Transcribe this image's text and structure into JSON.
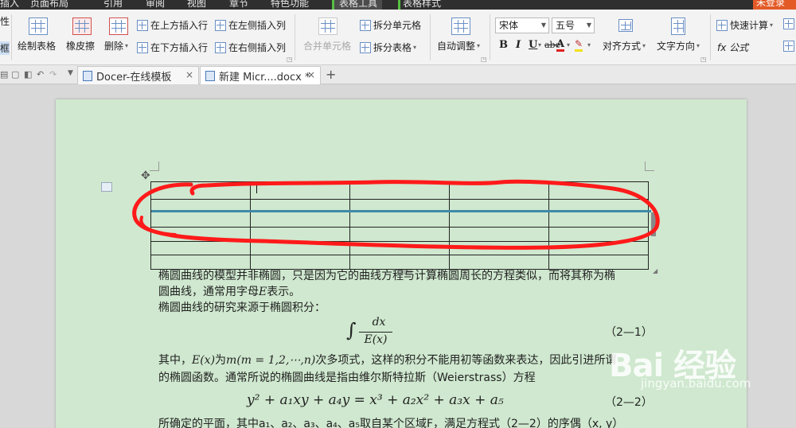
{
  "menubar": {
    "tabs": [
      "插入",
      "页面布局",
      "引用",
      "审阅",
      "视图",
      "章节",
      "特色功能",
      "表格工具",
      "表格样式"
    ],
    "login": "未登录"
  },
  "ribbon": {
    "left_partial_1": "性",
    "left_partial_2": "框",
    "draw_table": "绘制表格",
    "eraser": "橡皮擦",
    "delete": "删除",
    "insert_above": "在上方插入行",
    "insert_below": "在下方插入行",
    "insert_left": "在左侧插入列",
    "insert_right": "在右侧插入列",
    "merge_cells": "合并单元格",
    "split_cells": "拆分单元格",
    "split_table": "拆分表格",
    "auto_adjust": "自动调整",
    "font_name": "宋体",
    "font_size": "五号",
    "bold": "B",
    "italic": "I",
    "underline": "U",
    "strike": "abc",
    "font_color": "A",
    "align": "对齐方式",
    "text_dir": "文字方向",
    "quick_calc": "快速计算",
    "formula": "fx 公式"
  },
  "tabs_row": {
    "tabs": [
      {
        "label": "Docer-在线模板",
        "close": "×"
      },
      {
        "label": "新建 Micr....docx *",
        "close": "×"
      }
    ],
    "add": "+"
  },
  "document": {
    "para1_line1": "椭圆曲线的模型并非椭圆，只是因为它的曲线方程与计算椭圆周长的方程类似，而将其称为椭",
    "para1_line2_a": "圆曲线，通常用字母",
    "para1_line2_var": "E",
    "para1_line2_b": "表示。",
    "para2": "椭圆曲线的研究来源于椭圆积分：",
    "eq1_int": "∫",
    "eq1_num": "dx",
    "eq1_den": "E(x)",
    "eq1_label": "（2—1）",
    "para3_a": "其中，",
    "para3_ex": "E(x)",
    "para3_b": "为",
    "para3_m": "m(m = 1,2,⋯,n)",
    "para3_c": "次多项式，这样的积分不能用初等函数来表达，因此引进所谓",
    "para4": "的椭圆函数。通常所说的椭圆曲线是指由维尔斯特拉斯（Weierstrass）方程",
    "eq2": "y² + a₁xy + a₄y = x³ + a₂x² + a₃x + a₅",
    "eq2_label": "（2—2）",
    "para5": "所确定的平面，其中a₁、a₂、a₃、a₄、a₅取自某个区域F，满足方程式（2—2）的序偶（x, y）"
  },
  "watermark": {
    "logo": "Bai 经验",
    "url": "jingyan.baidu.com"
  },
  "colors": {
    "page_bg": "#cfe8cf",
    "annotation_red": "#ff1a1a",
    "table_tools_tab": "#57c043",
    "login_bg": "#e35a27"
  }
}
